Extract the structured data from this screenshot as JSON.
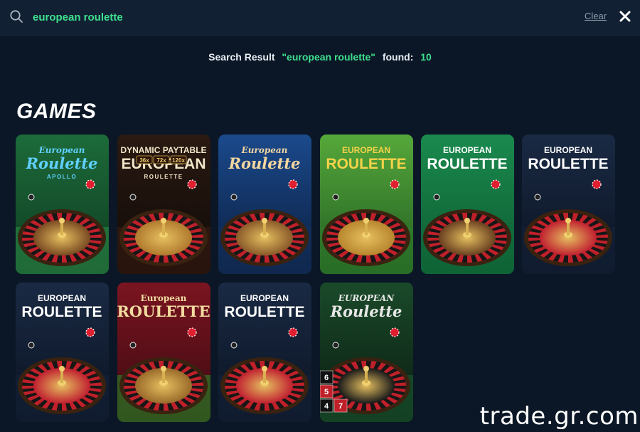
{
  "search": {
    "query": "european roulette",
    "clear_label": "Clear"
  },
  "result": {
    "prefix": "Search Result",
    "query_quoted": "\"european roulette\"",
    "found_label": "found:",
    "count": "10"
  },
  "section": {
    "title": "GAMES"
  },
  "games": [
    {
      "title_line1": "European",
      "title_line2": "Roulette",
      "subtitle": "APOLLO",
      "theme": "green-apollo"
    },
    {
      "title_line1": "DYNAMIC PAYTABLE",
      "title_line2": "EUROPEAN",
      "subtitle": "ROULETTE",
      "multipliers": [
        "36x",
        "72x",
        "120x"
      ],
      "theme": "dark-gold"
    },
    {
      "title_line1": "European",
      "title_line2": "Roulette",
      "subtitle": "",
      "theme": "blue-script"
    },
    {
      "title_line1": "EUROPEAN",
      "title_line2": "ROULETTE",
      "subtitle": "",
      "theme": "green-gold"
    },
    {
      "title_line1": "EUROPEAN",
      "title_line2": "ROULETTE",
      "subtitle": "",
      "theme": "green-flat"
    },
    {
      "title_line1": "EUROPEAN",
      "title_line2": "ROULETTE",
      "subtitle": "",
      "theme": "dark-blue"
    },
    {
      "title_line1": "EUROPEAN",
      "title_line2": "ROULETTE",
      "subtitle": "",
      "theme": "dark-blue"
    },
    {
      "title_line1": "European",
      "title_line2": "ROULETTE",
      "subtitle": "",
      "theme": "red-green"
    },
    {
      "title_line1": "EUROPEAN",
      "title_line2": "ROULETTE",
      "subtitle": "",
      "theme": "dark-blue"
    },
    {
      "title_line1": "EUROPEAN",
      "title_line2": "Roulette",
      "subtitle": "",
      "numbers": [
        "6",
        "5",
        "4",
        "7"
      ],
      "theme": "dark-green-table"
    }
  ],
  "watermark": "trade.gr.com",
  "colors": {
    "background": "#0b1726",
    "search_bar": "#122033",
    "accent_green": "#3ee08f"
  }
}
